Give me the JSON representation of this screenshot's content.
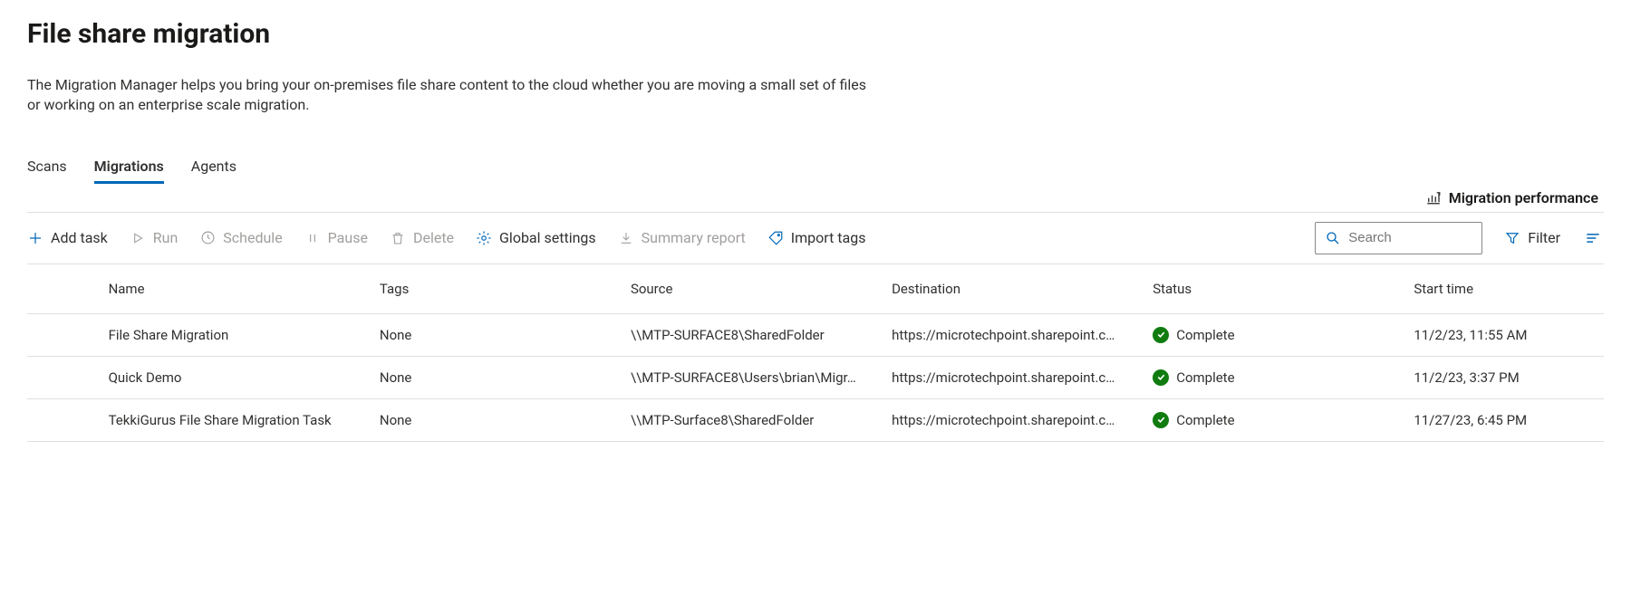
{
  "header": {
    "title": "File share migration",
    "description": "The Migration Manager helps you bring your on-premises file share content to the cloud whether you are moving a small set of files or working on an enterprise scale migration."
  },
  "tabs": [
    {
      "label": "Scans",
      "active": false
    },
    {
      "label": "Migrations",
      "active": true
    },
    {
      "label": "Agents",
      "active": false
    }
  ],
  "performance_link": "Migration performance",
  "toolbar": {
    "add_task": "Add task",
    "run": "Run",
    "schedule": "Schedule",
    "pause": "Pause",
    "delete": "Delete",
    "global_settings": "Global settings",
    "summary_report": "Summary report",
    "import_tags": "Import tags"
  },
  "search": {
    "placeholder": "Search"
  },
  "filter_label": "Filter",
  "columns": {
    "name": "Name",
    "tags": "Tags",
    "source": "Source",
    "destination": "Destination",
    "status": "Status",
    "start_time": "Start time"
  },
  "rows": [
    {
      "name": "File Share Migration",
      "tags": "None",
      "source": "\\\\MTP-SURFACE8\\SharedFolder",
      "destination": "https://microtechpoint.sharepoint.c…",
      "status": "Complete",
      "start_time": "11/2/23, 11:55 AM"
    },
    {
      "name": "Quick Demo",
      "tags": "None",
      "source": "\\\\MTP-SURFACE8\\Users\\brian\\Migr…",
      "destination": "https://microtechpoint.sharepoint.c…",
      "status": "Complete",
      "start_time": "11/2/23, 3:37 PM"
    },
    {
      "name": "TekkiGurus File Share Migration Task",
      "tags": "None",
      "source": "\\\\MTP-Surface8\\SharedFolder",
      "destination": "https://microtechpoint.sharepoint.c…",
      "status": "Complete",
      "start_time": "11/27/23, 6:45 PM"
    }
  ],
  "colors": {
    "accent": "#0067b8",
    "success": "#107c10",
    "disabled": "#a19f9d"
  }
}
